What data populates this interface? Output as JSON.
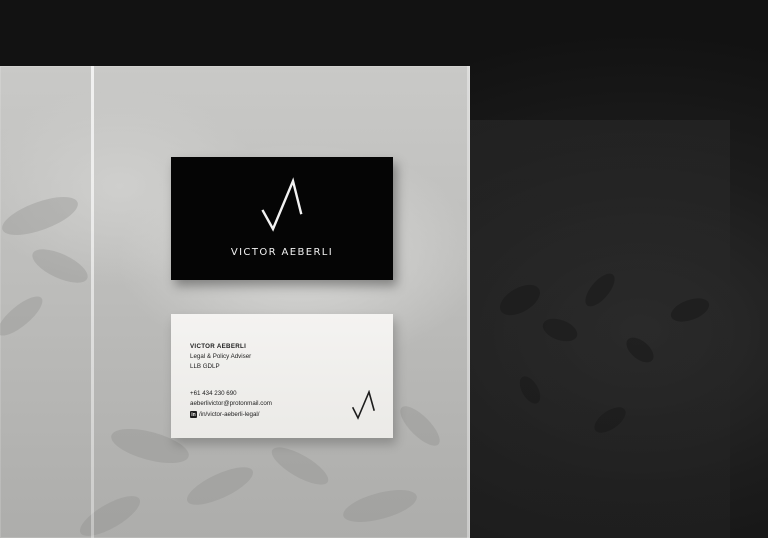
{
  "scene": {
    "description_icons": [
      "va-monogram-icon",
      "linkedin-icon"
    ],
    "colors": {
      "card_front_bg": "#050505",
      "card_back_bg": "#f0efec",
      "ink_dark": "#1d1d1d",
      "ink_light": "#f2f2f2"
    }
  },
  "card_front": {
    "name": "VICTOR AEBERLI"
  },
  "card_back": {
    "name": "VICTOR AEBERLI",
    "role": "Legal & Policy Adviser",
    "credentials": "LLB GDLP",
    "phone": "+61 434 230 690",
    "email": "aeberlivictor@protonmail.com",
    "linkedin_icon_label": "in",
    "linkedin": "/in/victor-aeberli-legal/"
  }
}
